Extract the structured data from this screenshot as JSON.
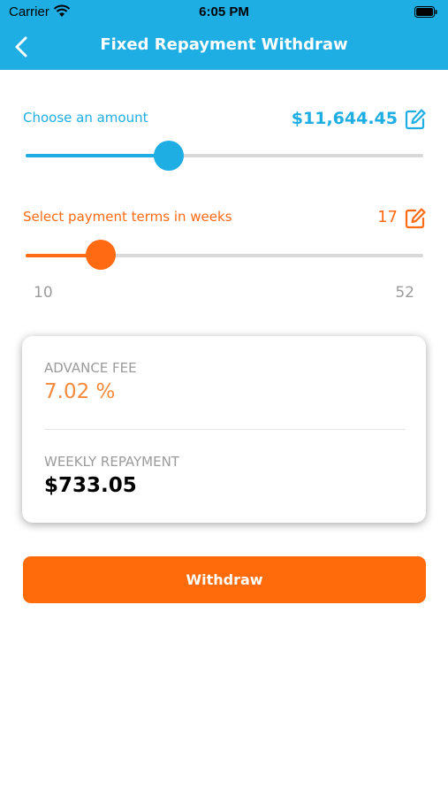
{
  "status_bar": {
    "carrier": "Carrier",
    "time": "6:05 PM"
  },
  "nav": {
    "title": "Fixed Repayment Withdraw"
  },
  "amount": {
    "label": "Choose an amount",
    "value": "$11,644.45",
    "slider_fraction": 0.36
  },
  "weeks": {
    "label": "Select payment terms in weeks",
    "value": "17",
    "min": "10",
    "max": "52",
    "slider_fraction": 0.19
  },
  "summary": {
    "fee_label": "ADVANCE FEE",
    "fee_value": "7.02 %",
    "repayment_label": "WEEKLY REPAYMENT",
    "repayment_value": "$733.05"
  },
  "actions": {
    "withdraw_label": "Withdraw"
  },
  "colors": {
    "brand_blue": "#1EAEE4",
    "accent_orange": "#FF6A13"
  }
}
